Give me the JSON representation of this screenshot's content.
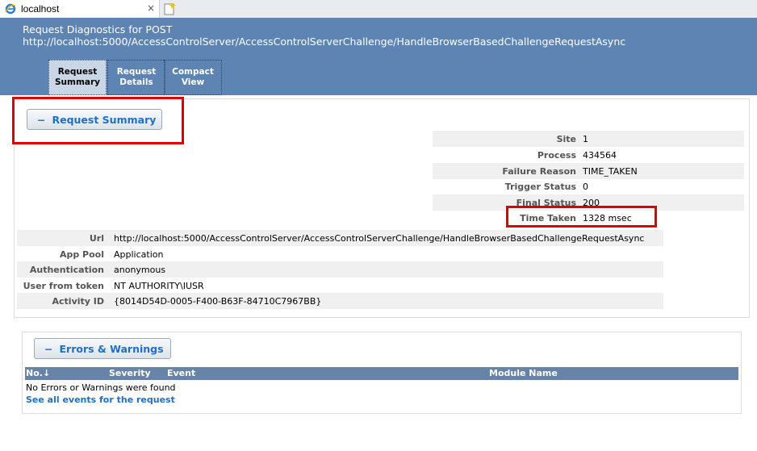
{
  "browser": {
    "tab_title": "localhost",
    "close_glyph": "×",
    "icons": [
      "ie-icon",
      "new-tab-icon"
    ]
  },
  "header": {
    "line1": "Request Diagnostics for POST",
    "line2": "http://localhost:5000/AccessControlServer/AccessControlServerChallenge/HandleBrowserBasedChallengeRequestAsync"
  },
  "nav_tabs": [
    {
      "line1": "Request",
      "line2": "Summary",
      "active": true
    },
    {
      "line1": "Request",
      "line2": "Details",
      "active": false
    },
    {
      "line1": "Compact",
      "line2": "View",
      "active": false
    }
  ],
  "summary": {
    "button_label": "Request Summary",
    "toggle_glyph": "−",
    "right_rows": [
      {
        "label": "Site",
        "value": "1"
      },
      {
        "label": "Process",
        "value": "434564"
      },
      {
        "label": "Failure Reason",
        "value": "TIME_TAKEN"
      },
      {
        "label": "Trigger Status",
        "value": "0"
      },
      {
        "label": "Final Status",
        "value": "200"
      },
      {
        "label": "Time Taken",
        "value": "1328 msec"
      }
    ],
    "left_rows": [
      {
        "label": "Url",
        "value": "http://localhost:5000/AccessControlServer/AccessControlServerChallenge/HandleBrowserBasedChallengeRequestAsync"
      },
      {
        "label": "App Pool",
        "value": "Application"
      },
      {
        "label": "Authentication",
        "value": "anonymous"
      },
      {
        "label": "User from token",
        "value": "NT AUTHORITY\\IUSR"
      },
      {
        "label": "Activity ID",
        "value": "{8014D54D-0005-F400-B63F-84710C7967BB}"
      }
    ]
  },
  "errors": {
    "button_label": "Errors & Warnings",
    "toggle_glyph": "−",
    "columns": {
      "no": "No.↓",
      "severity": "Severity",
      "event": "Event",
      "module": "Module Name"
    },
    "empty_message": "No Errors or Warnings were found",
    "see_all_link": "See all events for the request"
  },
  "colors": {
    "header_bg": "#5d84b3",
    "active_tab": "#c9d6e6",
    "link": "#1f6fc8",
    "highlight": "#e00000",
    "grid_head": "#6783a8"
  }
}
